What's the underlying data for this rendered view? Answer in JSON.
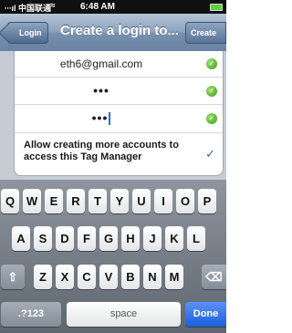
{
  "status_bar": {
    "carrier": "∙∙∙ıl 中国联通",
    "wifi_icon": "≈",
    "time": "6:48 AM"
  },
  "nav": {
    "back_label": "Login",
    "title": "Create a login to...",
    "create_label": "Create"
  },
  "form": {
    "email_value": "eth6@gmail.com",
    "password_mask": "•••",
    "confirm_mask": "•••",
    "check_glyph": "✓",
    "allow_label": "Allow creating more accounts to access this Tag Manager",
    "allow_check": "✓"
  },
  "keyboard": {
    "row1": [
      "Q",
      "W",
      "E",
      "R",
      "T",
      "Y",
      "U",
      "I",
      "O",
      "P"
    ],
    "row2": [
      "A",
      "S",
      "D",
      "F",
      "G",
      "H",
      "J",
      "K",
      "L"
    ],
    "row3": [
      "Z",
      "X",
      "C",
      "V",
      "B",
      "N",
      "M"
    ],
    "shift_icon": "⇧",
    "delete_icon": "⌫",
    "numbers_label": ".?123",
    "space_label": "space",
    "done_label": "Done"
  },
  "colors": {
    "nav_blue": "#7990ae",
    "done_blue": "#1c5fe0",
    "check_green": "#3a9a1c"
  }
}
